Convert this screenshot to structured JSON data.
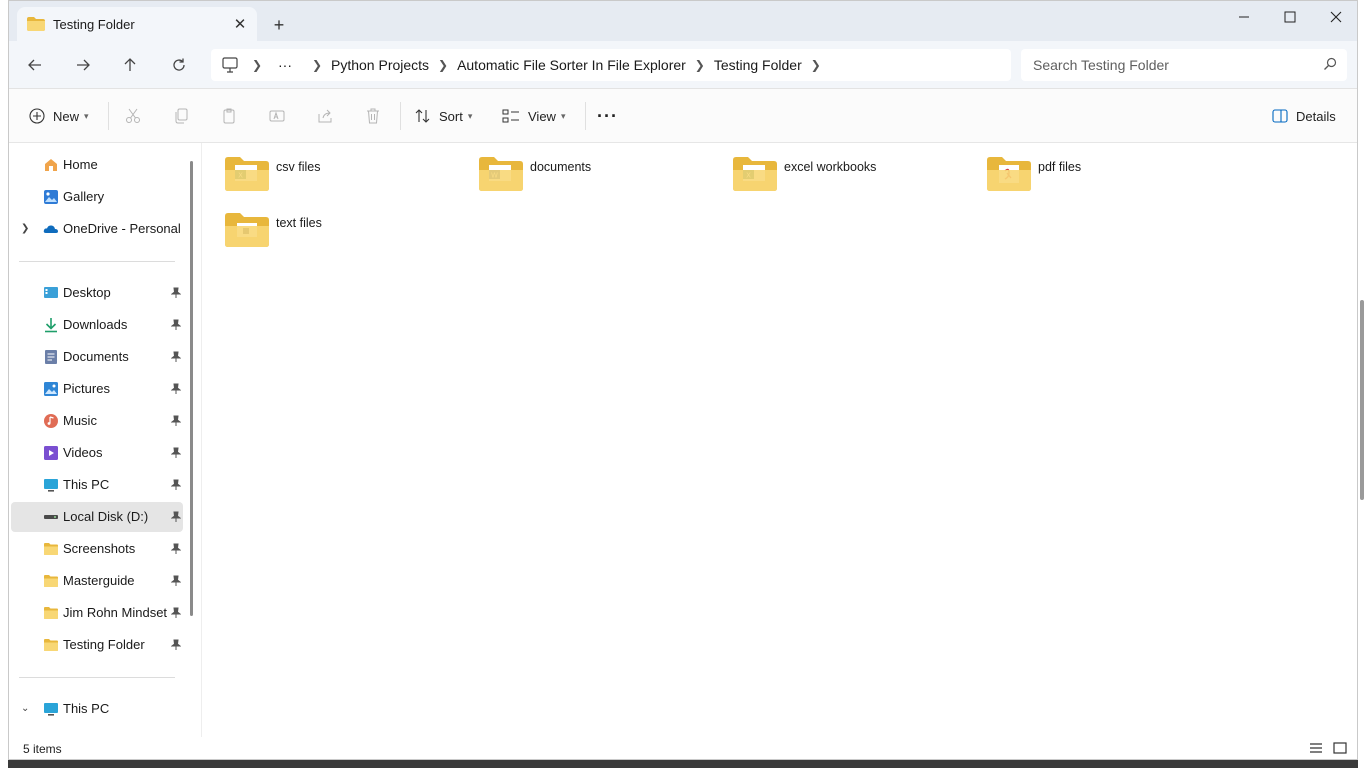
{
  "window": {
    "tab_title": "Testing Folder",
    "new_tab": "+",
    "controls": [
      "minimize",
      "maximize",
      "close"
    ]
  },
  "address": {
    "breadcrumb": [
      "Python Projects",
      "Automatic File Sorter In File Explorer",
      "Testing Folder"
    ],
    "more": "···",
    "search_placeholder": "Search Testing Folder"
  },
  "toolbar": {
    "new_label": "New",
    "sort_label": "Sort",
    "view_label": "View",
    "more_label": "···",
    "details_label": "Details"
  },
  "sidebar": {
    "top": [
      {
        "label": "Home",
        "icon": "home-icon"
      },
      {
        "label": "Gallery",
        "icon": "gallery-icon"
      },
      {
        "label": "OneDrive - Personal",
        "icon": "cloud-icon"
      }
    ],
    "quick": [
      {
        "label": "Desktop",
        "icon": "desktop-icon"
      },
      {
        "label": "Downloads",
        "icon": "download-icon"
      },
      {
        "label": "Documents",
        "icon": "documents-icon"
      },
      {
        "label": "Pictures",
        "icon": "pictures-icon"
      },
      {
        "label": "Music",
        "icon": "music-icon"
      },
      {
        "label": "Videos",
        "icon": "videos-icon"
      },
      {
        "label": "This PC",
        "icon": "monitor-icon"
      },
      {
        "label": "Local Disk (D:)",
        "icon": "drive-icon"
      },
      {
        "label": "Screenshots",
        "icon": "folder-icon"
      },
      {
        "label": "Masterguide",
        "icon": "folder-icon"
      },
      {
        "label": "Jim Rohn Mindset L",
        "icon": "folder-icon"
      },
      {
        "label": "Testing Folder",
        "icon": "folder-icon"
      }
    ],
    "bottom": [
      {
        "label": "This PC",
        "icon": "monitor-icon"
      }
    ],
    "selected": "Local Disk (D:)"
  },
  "content": {
    "folders": [
      {
        "name": "csv files",
        "badge": "excel",
        "badge_color": "#1e7145"
      },
      {
        "name": "documents",
        "badge": "word",
        "badge_color": "#2b579a"
      },
      {
        "name": "excel workbooks",
        "badge": "excel",
        "badge_color": "#1e7145"
      },
      {
        "name": "pdf files",
        "badge": "pdf",
        "badge_color": "#d83b3b"
      },
      {
        "name": "text files",
        "badge": "text",
        "badge_color": "#444444"
      }
    ]
  },
  "status": {
    "items_count": "5 items"
  },
  "colors": {
    "folder_body": "#f8d775",
    "folder_back": "#e8b73c",
    "accent": "#0067c0"
  }
}
